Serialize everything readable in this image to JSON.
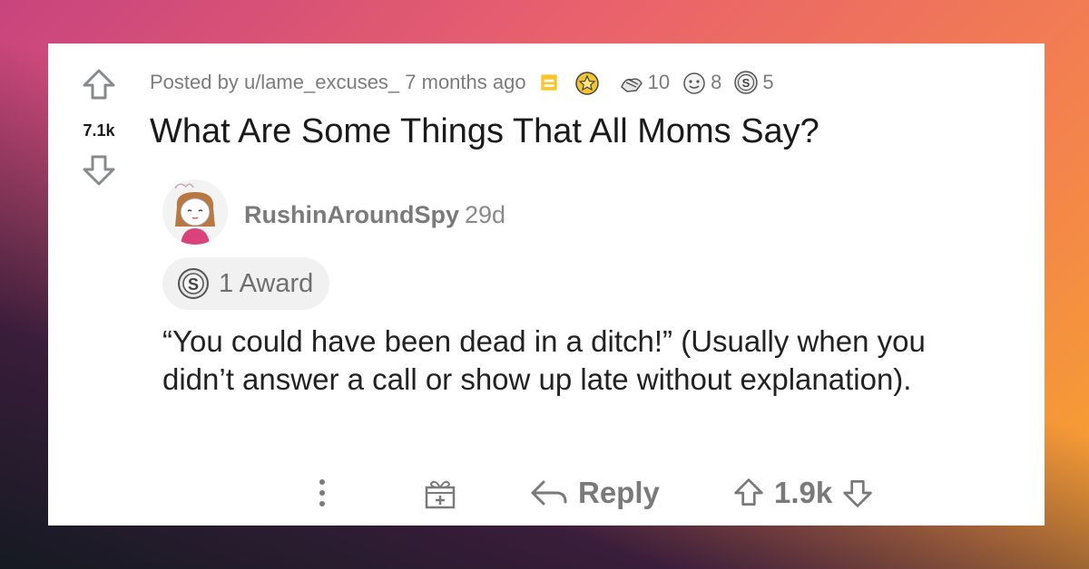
{
  "post": {
    "vote_score": "7.1k",
    "posted_by": "Posted by u/lame_excuses_ 7 months ago",
    "awards": [
      {
        "icon": "gold-star-award-icon",
        "count": ""
      },
      {
        "icon": "helpful-hands-award-icon",
        "count": "10"
      },
      {
        "icon": "wholesome-award-icon",
        "count": "8"
      },
      {
        "icon": "silver-award-icon",
        "count": "5"
      }
    ],
    "title": "What Are Some Things That All Moms Say?"
  },
  "comment": {
    "username": "RushinAroundSpy",
    "age": "29d",
    "award_label": "1 Award",
    "text": "“You could have been dead in a ditch!” (Usually when you didn’t answer a call or show up late without explanation).",
    "reply_label": "Reply",
    "score": "1.9k"
  },
  "colors": {
    "accent_orange": "#f7a52c",
    "icon_gray": "#878a8c",
    "text_dark": "#1a1a1b"
  }
}
